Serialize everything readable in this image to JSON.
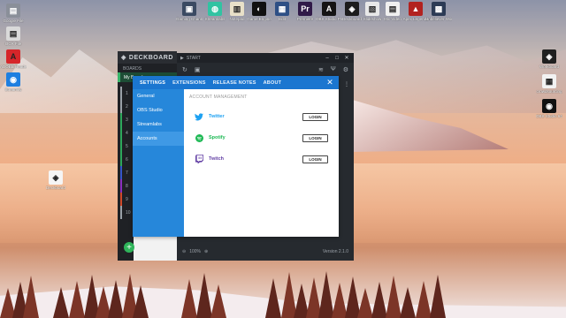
{
  "desktop": {
    "icons_left": [
      {
        "label": "Google File",
        "color": "#8a8f99",
        "glyph": "▤"
      },
      {
        "label": "OCR File",
        "color": "#d9d9d9",
        "glyph": "▤"
      },
      {
        "label": "ADOBE Reader",
        "color": "#d6262a",
        "glyph": "A"
      },
      {
        "label": "Streamify",
        "color": "#1e7fe0",
        "glyph": "◉"
      }
    ],
    "icons_top": [
      {
        "label": "Gaming Channel",
        "color": "#3b4a62",
        "glyph": "▣"
      },
      {
        "label": "Streamlabs",
        "color": "#31c3a2",
        "glyph": "◍"
      },
      {
        "label": "Notepad",
        "color": "#e8e0c8",
        "glyph": "▥"
      },
      {
        "label": "Game Engine",
        "color": "#101010",
        "glyph": "◐"
      },
      {
        "label": "Edit",
        "color": "#2d4f85",
        "glyph": "▦"
      },
      {
        "label": "Premiere",
        "color": "#301a48",
        "glyph": "Pr"
      },
      {
        "label": "OBS Studio Preview",
        "color": "#141414",
        "glyph": "A"
      },
      {
        "label": "Deckboard",
        "color": "#1c1c1c",
        "glyph": "◈"
      },
      {
        "label": "Slideshow",
        "color": "#e8e8e8",
        "glyph": "▧"
      },
      {
        "label": "Mic Video",
        "color": "#f0f0f0",
        "glyph": "▤"
      },
      {
        "label": "Apex Legends",
        "color": "#b2221f",
        "glyph": "▲"
      },
      {
        "label": "Unbeliever Worldwide",
        "color": "#2c3b55",
        "glyph": "▩"
      }
    ],
    "icons_right": [
      {
        "label": "Workboard",
        "color": "#202020",
        "glyph": "◈"
      },
      {
        "label": "crowdsourcing",
        "color": "#f2f2f2",
        "glyph": "▦"
      },
      {
        "label": "OBS Studio 64-bit",
        "color": "#111111",
        "glyph": "◉"
      }
    ],
    "icon_mid": {
      "label": "Deckboard",
      "color": "#f5f5f5",
      "glyph": "◈"
    }
  },
  "deckboard_window": {
    "brand": "DECKBOARD",
    "boards_label": "BOARDS",
    "selected_board": "My Board",
    "list_numbers": [
      "1",
      "2",
      "3",
      "4",
      "5",
      "6",
      "7",
      "8",
      "9",
      "10"
    ],
    "list_colors": [
      "#9aa1a8",
      "#9aa1a8",
      "#2ea85b",
      "#2ea85b",
      "#2ea85b",
      "#2ea85b",
      "#3556c9",
      "#8a2fbf",
      "#d04a2a",
      "#9aa1a8"
    ],
    "add_label": "+"
  },
  "app_window": {
    "title": "START",
    "zoom": "100%",
    "version": "Version 2.1.0"
  },
  "settings": {
    "tabs": [
      "SETTINGS",
      "EXTENSIONS",
      "RELEASE NOTES",
      "ABOUT"
    ],
    "active_tab": 0,
    "side_items": [
      "General",
      "OBS Studio",
      "Streamlabs",
      "Accounts"
    ],
    "active_side": 3,
    "heading": "ACCOUNT MANAGEMENT",
    "accounts": [
      {
        "name": "Twitter",
        "color": "#1da1f2",
        "button": "LOGIN",
        "icon": "twitter-icon"
      },
      {
        "name": "Spotify",
        "color": "#1db954",
        "button": "LOGIN",
        "icon": "spotify-icon"
      },
      {
        "name": "Twitch",
        "color": "#6441a5",
        "button": "LOGIN",
        "icon": "twitch-icon"
      }
    ]
  }
}
